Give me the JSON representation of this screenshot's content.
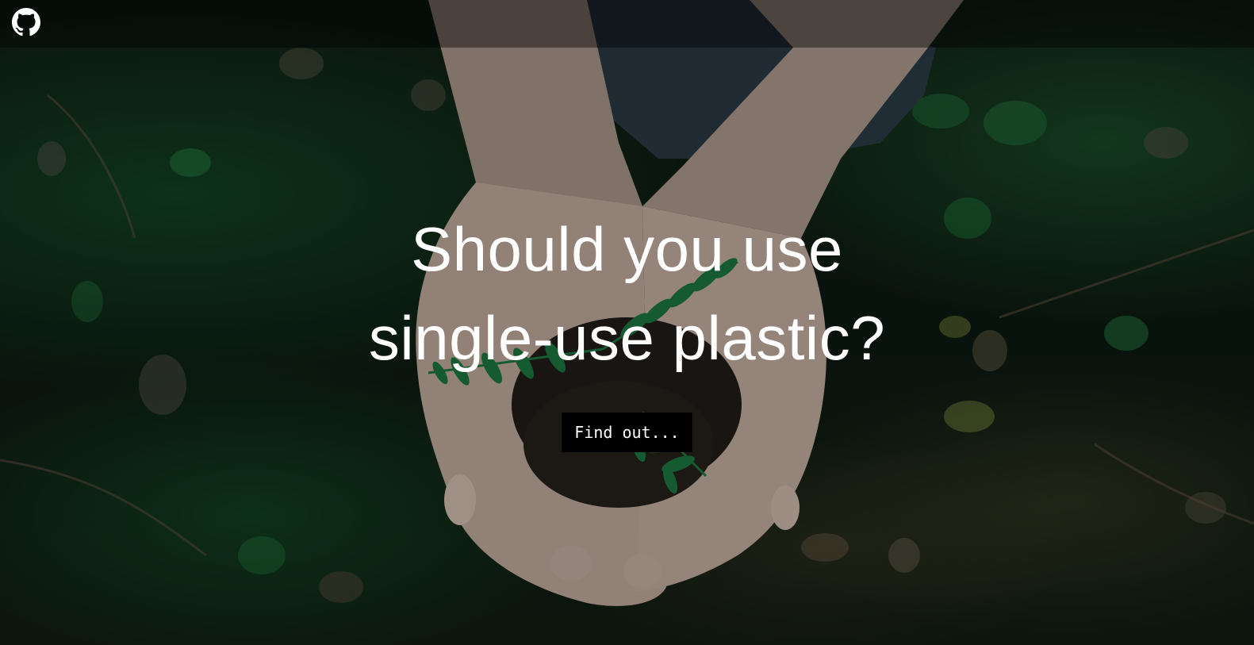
{
  "header": {
    "github_icon": "github-icon"
  },
  "hero": {
    "title_line_1": "Should you use",
    "title_line_2": "single-use plastic?",
    "cta_label": "Find out..."
  },
  "colors": {
    "topbar": "rgba(0,0,0,0.42)",
    "title_text": "#ffffff",
    "cta_background": "#000000",
    "cta_text": "#ffffff"
  }
}
